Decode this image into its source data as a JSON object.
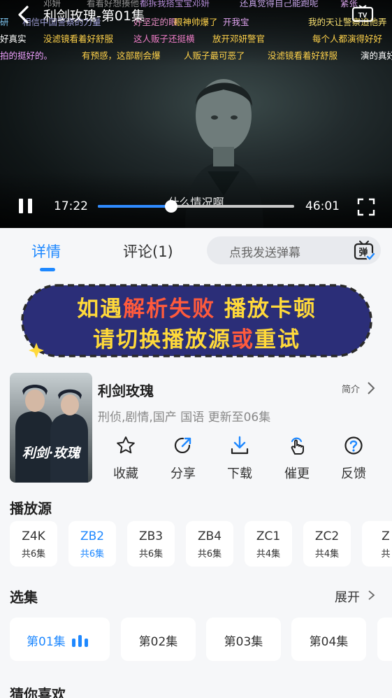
{
  "player": {
    "title": "利剑玫瑰-第01集",
    "current_time": "17:22",
    "total_time": "46:01",
    "progress": 0.375,
    "subtitle": "什么情况啊",
    "danmaku": [
      {
        "text": "邓妍",
        "color": "#9a9a9a"
      },
      {
        "text": "看着好想揍他",
        "color": "#8e8e8e"
      },
      {
        "text": "都拆我搭宝宝邓妍",
        "color": "#b48bd6"
      },
      {
        "text": "还真觉得自己能跑呢",
        "color": "#c4a2e6"
      },
      {
        "text": "紧张",
        "color": "#d6a0e8"
      },
      {
        "text": "研",
        "color": "#7fc6f2"
      },
      {
        "text": "相信中国警察的力量",
        "color": "#a0a0d8"
      },
      {
        "text": "好坚定的眼",
        "color": "#e58cc4"
      },
      {
        "text": "眼神帅爆了",
        "color": "#ffd24a"
      },
      {
        "text": "开我宝",
        "color": "#e0a4f0"
      },
      {
        "text": "我的天让警察追他弄",
        "color": "#f8e070"
      },
      {
        "text": "好真实",
        "color": "#ffffff"
      },
      {
        "text": "没滤镜看着好舒服",
        "color": "#ffd24a"
      },
      {
        "text": "这人贩子还挺横",
        "color": "#f07ec8"
      },
      {
        "text": "放开邓妍警官",
        "color": "#ffd24a"
      },
      {
        "text": "每个人都演得好好",
        "color": "#ffd24a"
      },
      {
        "text": "拍的挺好的。",
        "color": "#f0a0ff"
      },
      {
        "text": "有预感，这部剧会爆",
        "color": "#ffd24a"
      },
      {
        "text": "人贩子最可恶了",
        "color": "#ffd24a"
      },
      {
        "text": "没滤镜看着好舒服",
        "color": "#ffd24a"
      },
      {
        "text": "演的真好",
        "color": "#ffffff"
      }
    ]
  },
  "tabs": {
    "details": "详情",
    "comments": "评论(1)"
  },
  "danmaku_input": {
    "placeholder": "点我发送弹幕",
    "icon_char": "弹"
  },
  "banner": {
    "line1_a": "如遇",
    "line1_b": "解析失败",
    "line1_c": " 播放卡顿",
    "line2_a": "请切换播放源",
    "line2_b": "或",
    "line2_c": "重试"
  },
  "show": {
    "poster_text": "利剑·玫瑰",
    "title": "利剑玫瑰",
    "intro_label": "简介",
    "meta": "刑侦,剧情,国产 国语 更新至06集",
    "actions": [
      "收藏",
      "分享",
      "下载",
      "催更",
      "反馈"
    ]
  },
  "sources": {
    "title": "播放源",
    "items": [
      {
        "code": "Z4K",
        "count": "共6集",
        "active": false
      },
      {
        "code": "ZB2",
        "count": "共6集",
        "active": true
      },
      {
        "code": "ZB3",
        "count": "共6集",
        "active": false
      },
      {
        "code": "ZB4",
        "count": "共6集",
        "active": false
      },
      {
        "code": "ZC1",
        "count": "共4集",
        "active": false
      },
      {
        "code": "ZC2",
        "count": "共4集",
        "active": false
      },
      {
        "code": "Z",
        "count": "共",
        "active": false
      }
    ]
  },
  "episodes": {
    "title": "选集",
    "expand_label": "展开",
    "items": [
      "第01集",
      "第02集",
      "第03集",
      "第04集"
    ],
    "active_index": 0
  },
  "recommend": {
    "title": "猜你喜欢"
  },
  "colors": {
    "accent": "#1e88ff",
    "banner_bg": "#2b2e78",
    "banner_yellow": "#ffd93a",
    "banner_red": "#ff5a3c"
  }
}
